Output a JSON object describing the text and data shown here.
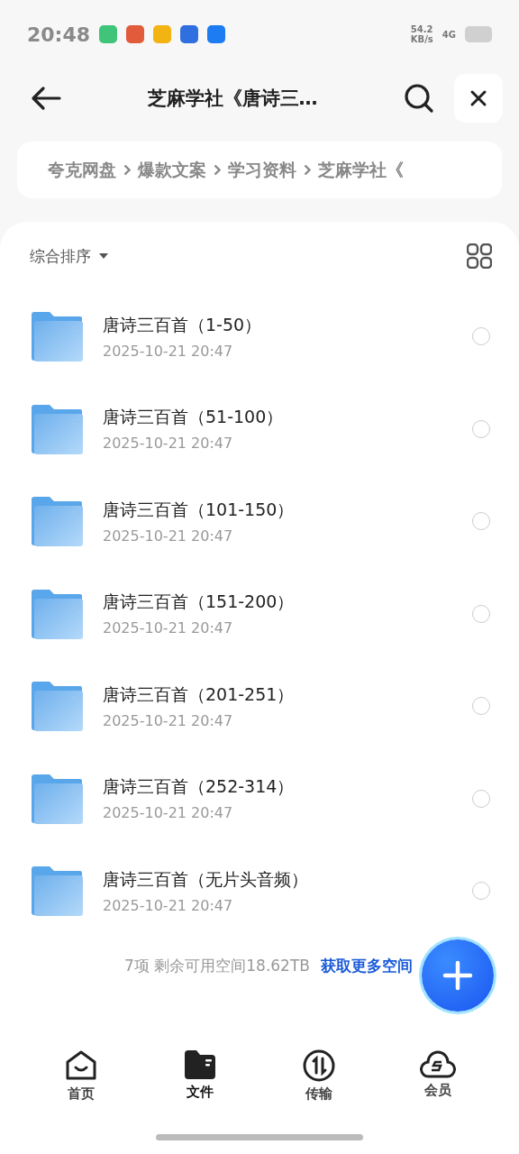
{
  "status_bar": {
    "time": "20:48",
    "speed_value": "54.2",
    "speed_unit": "KB/s",
    "network": "4G"
  },
  "header": {
    "title": "芝麻学社《唐诗三…"
  },
  "breadcrumb": [
    "夸克网盘",
    "爆款文案",
    "学习资料",
    "芝麻学社《"
  ],
  "toolbar": {
    "sort_label": "综合排序"
  },
  "files": [
    {
      "name": "唐诗三百首（1-50）",
      "date": "2025-10-21 20:47",
      "selected": false
    },
    {
      "name": "唐诗三百首（51-100）",
      "date": "2025-10-21 20:47",
      "selected": false
    },
    {
      "name": "唐诗三百首（101-150）",
      "date": "2025-10-21 20:47",
      "selected": false
    },
    {
      "name": "唐诗三百首（151-200）",
      "date": "2025-10-21 20:47",
      "selected": false
    },
    {
      "name": "唐诗三百首（201-251）",
      "date": "2025-10-21 20:47",
      "selected": false
    },
    {
      "name": "唐诗三百首（252-314）",
      "date": "2025-10-21 20:47",
      "selected": false
    },
    {
      "name": "唐诗三百首（无片头音频）",
      "date": "2025-10-21 20:47",
      "selected": false
    }
  ],
  "footer": {
    "summary": "7项 剩余可用空间18.62TB",
    "link": "获取更多空间"
  },
  "nav": [
    {
      "kind": "home",
      "label": "首页",
      "selected": false
    },
    {
      "kind": "files",
      "label": "文件",
      "selected": true
    },
    {
      "kind": "transfer",
      "label": "传输",
      "selected": false
    },
    {
      "kind": "member",
      "label": "会员",
      "selected": false
    }
  ]
}
